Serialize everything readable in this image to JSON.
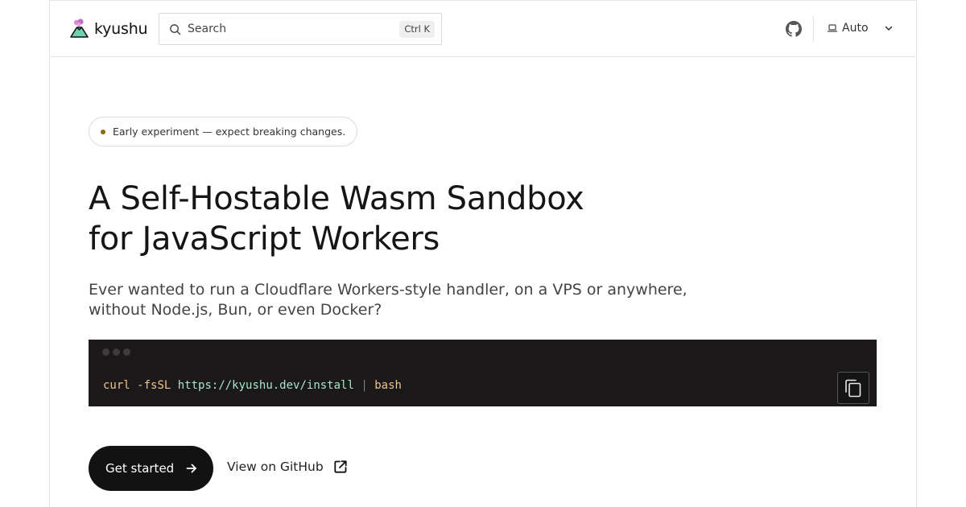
{
  "header": {
    "logo_text": "kyushu",
    "search_placeholder": "Search",
    "search_shortcut": "Ctrl K",
    "theme_label": "Auto"
  },
  "hero": {
    "badge": "Early experiment — expect breaking changes.",
    "title_line1": "A Self-Hostable Wasm Sandbox",
    "title_line2": "for JavaScript Workers",
    "subtitle_line1": "Ever wanted to run a Cloudflare Workers-style handler, on a VPS or anywhere,",
    "subtitle_line2": "without Node.js, Bun, or even Docker?"
  },
  "code": {
    "cmd": "curl",
    "flag": "-fsSL",
    "url": "https://kyushu.dev/install",
    "pipe": "|",
    "shell": "bash"
  },
  "actions": {
    "primary_label": "Get started",
    "secondary_label": "View on GitHub"
  },
  "colors": {
    "accent_dot": "#8a6b12",
    "code_bg": "#1a1818",
    "cta_bg": "#121212"
  },
  "icons": {
    "logo": "volcano-icon",
    "search": "search-icon",
    "github": "github-icon",
    "theme": "laptop-icon",
    "chevron": "chevron-down-icon",
    "copy": "copy-icon",
    "arrow": "arrow-right-icon",
    "external": "external-link-icon"
  }
}
